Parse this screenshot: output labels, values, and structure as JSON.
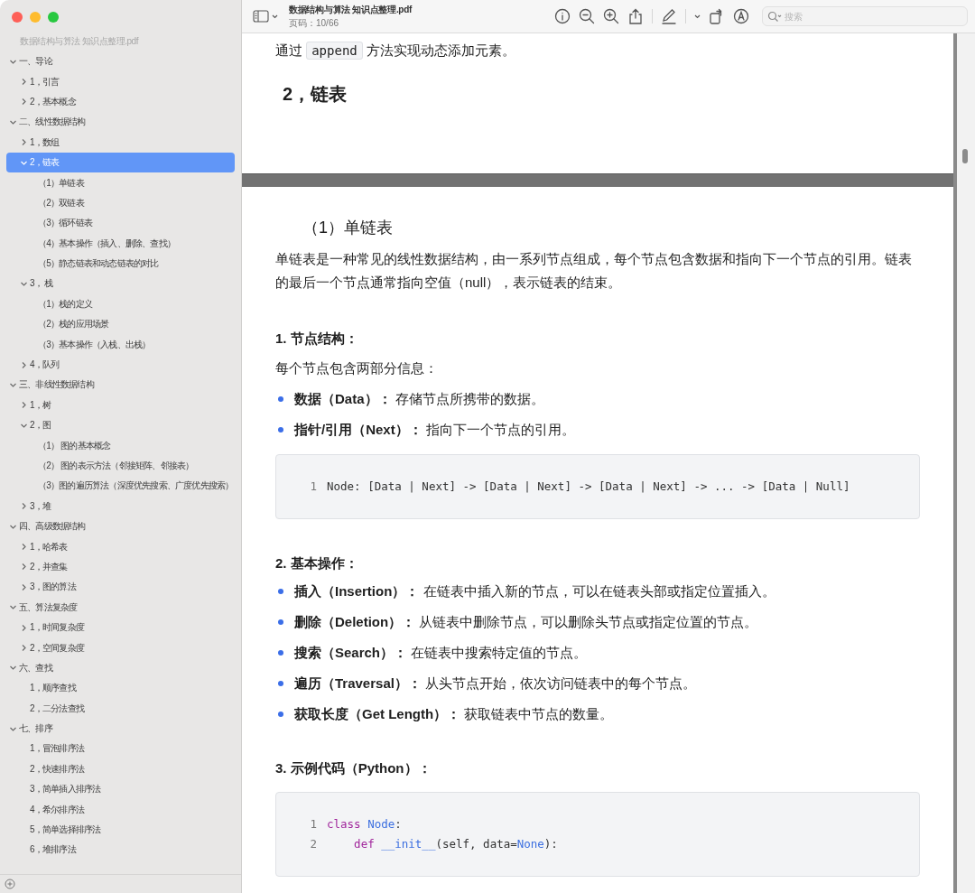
{
  "window": {
    "title": "数据结构与算法 知识点整理.pdf",
    "page_indicator": "页码：10/66"
  },
  "search": {
    "placeholder": "搜索"
  },
  "sidebar": {
    "title": "数据结构与算法 知识点整理.pdf",
    "outline": [
      {
        "label": "一、导论",
        "kind": "branch",
        "expanded": true,
        "selected": false,
        "children": [
          {
            "label": "1，引言",
            "kind": "branch",
            "expanded": false,
            "selected": false
          },
          {
            "label": "2，基本概念",
            "kind": "branch",
            "expanded": false,
            "selected": false
          }
        ]
      },
      {
        "label": "二、线性数据结构",
        "kind": "branch",
        "expanded": true,
        "selected": false,
        "children": [
          {
            "label": "1，数组",
            "kind": "branch",
            "expanded": false,
            "selected": false
          },
          {
            "label": "2，链表",
            "kind": "branch",
            "expanded": true,
            "selected": true,
            "children": [
              {
                "label": "（1）单链表",
                "kind": "leaf",
                "selected": false
              },
              {
                "label": "（2）双链表",
                "kind": "leaf",
                "selected": false
              },
              {
                "label": "（3）循环链表",
                "kind": "leaf",
                "selected": false
              },
              {
                "label": "（4）基本操作（插入、删除、查找）",
                "kind": "leaf",
                "selected": false
              },
              {
                "label": "（5）静态链表和动态链表的对比",
                "kind": "leaf",
                "selected": false
              }
            ]
          },
          {
            "label": "3， 栈",
            "kind": "branch",
            "expanded": true,
            "selected": false,
            "children": [
              {
                "label": "（1）栈的定义",
                "kind": "leaf",
                "selected": false
              },
              {
                "label": "（2）栈的应用场景",
                "kind": "leaf",
                "selected": false
              },
              {
                "label": "（3）基本操作（入栈、出栈）",
                "kind": "leaf",
                "selected": false
              }
            ]
          },
          {
            "label": "4，队列",
            "kind": "branch",
            "expanded": false,
            "selected": false
          }
        ]
      },
      {
        "label": "三、非线性数据结构",
        "kind": "branch",
        "expanded": true,
        "selected": false,
        "children": [
          {
            "label": "1，树",
            "kind": "branch",
            "expanded": false,
            "selected": false
          },
          {
            "label": "2，图",
            "kind": "branch",
            "expanded": true,
            "selected": false,
            "children": [
              {
                "label": "（1） 图的基本概念",
                "kind": "leaf",
                "selected": false
              },
              {
                "label": "（2） 图的表示方法（邻接矩阵、邻接表）",
                "kind": "leaf",
                "selected": false
              },
              {
                "label": "（3）图的遍历算法（深度优先搜索、广度优先搜索）",
                "kind": "leaf",
                "selected": false
              }
            ]
          },
          {
            "label": "3，堆",
            "kind": "branch",
            "expanded": false,
            "selected": false
          }
        ]
      },
      {
        "label": "四、高级数据结构",
        "kind": "branch",
        "expanded": true,
        "selected": false,
        "children": [
          {
            "label": "1，哈希表",
            "kind": "branch",
            "expanded": false,
            "selected": false
          },
          {
            "label": "2，并查集",
            "kind": "branch",
            "expanded": false,
            "selected": false
          },
          {
            "label": "3，图的算法",
            "kind": "branch",
            "expanded": false,
            "selected": false
          }
        ]
      },
      {
        "label": "五、算法复杂度",
        "kind": "branch",
        "expanded": true,
        "selected": false,
        "children": [
          {
            "label": "1，时间复杂度",
            "kind": "branch",
            "expanded": false,
            "selected": false
          },
          {
            "label": "2，空间复杂度",
            "kind": "branch",
            "expanded": false,
            "selected": false
          }
        ]
      },
      {
        "label": "六、查找",
        "kind": "branch",
        "expanded": true,
        "selected": false,
        "children": [
          {
            "label": "1，顺序查找",
            "kind": "leaf",
            "selected": false
          },
          {
            "label": "2，二分法查找",
            "kind": "leaf",
            "selected": false
          }
        ]
      },
      {
        "label": "七、排序",
        "kind": "branch",
        "expanded": true,
        "selected": false,
        "children": [
          {
            "label": "1，冒泡排序法",
            "kind": "leaf",
            "selected": false
          },
          {
            "label": "2，快速排序法",
            "kind": "leaf",
            "selected": false
          },
          {
            "label": "3，简单插入排序法",
            "kind": "leaf",
            "selected": false
          },
          {
            "label": "4，希尔排序法",
            "kind": "leaf",
            "selected": false
          },
          {
            "label": "5，简单选择排序法",
            "kind": "leaf",
            "selected": false
          },
          {
            "label": "6，堆排序法",
            "kind": "leaf",
            "selected": false
          }
        ]
      }
    ]
  },
  "document": {
    "pages": [
      {
        "blocks": [
          {
            "kind": "paragraph",
            "parts": [
              {
                "text": "通过 ",
                "kind": "plain"
              },
              {
                "text": "append",
                "kind": "code"
              },
              {
                "text": " 方法实现动态添加元素。",
                "kind": "plain"
              }
            ]
          },
          {
            "kind": "heading",
            "text": "2，链表"
          }
        ]
      },
      {
        "blocks": [
          {
            "kind": "subheading",
            "text": "（1）单链表"
          },
          {
            "kind": "paragraph",
            "parts": [
              {
                "text": "单链表是一种常见的线性数据结构，由一系列节点组成，每个节点包含数据和指向下一个节点的引用。链表的最后一个节点通常指向空值（null），表示链表的结束。",
                "kind": "plain"
              }
            ]
          },
          {
            "kind": "section",
            "text": "1. 节点结构："
          },
          {
            "kind": "paragraph",
            "parts": [
              {
                "text": "每个节点包含两部分信息：",
                "kind": "plain"
              }
            ]
          },
          {
            "kind": "bullets",
            "items": [
              "**数据（Data）：** 存储节点所携带的数据。",
              "**指针/引用（Next）：** 指向下一个节点的引用。"
            ]
          },
          {
            "kind": "code",
            "lines": [
              {
                "number": "1",
                "tokens": [
                  {
                    "text": "Node: [Data | Next] -> [Data | Next] -> [Data | Next] -> ... -> [Data | Null]",
                    "kind": "plain"
                  }
                ]
              }
            ]
          },
          {
            "kind": "section",
            "text": "2. 基本操作："
          },
          {
            "kind": "bullets",
            "items": [
              "**插入（Insertion）：** 在链表中插入新的节点，可以在链表头部或指定位置插入。",
              "**删除（Deletion）：** 从链表中删除节点，可以删除头节点或指定位置的节点。",
              "**搜索（Search）：** 在链表中搜索特定值的节点。",
              "**遍历（Traversal）：** 从头节点开始，依次访问链表中的每个节点。",
              "**获取长度（Get Length）：** 获取链表中节点的数量。"
            ]
          },
          {
            "kind": "section",
            "text": "3. 示例代码（Python）："
          },
          {
            "kind": "code",
            "lines": [
              {
                "number": "1",
                "tokens": [
                  {
                    "text": "class",
                    "kind": "keyword"
                  },
                  {
                    "text": " Node",
                    "kind": "name"
                  },
                  {
                    "text": ":",
                    "kind": "plain"
                  }
                ]
              },
              {
                "number": "2",
                "tokens": [
                  {
                    "text": "    def",
                    "kind": "keyword"
                  },
                  {
                    "text": " __init__",
                    "kind": "name"
                  },
                  {
                    "text": "(self, data=",
                    "kind": "plain"
                  },
                  {
                    "text": "None",
                    "kind": "name"
                  },
                  {
                    "text": "):",
                    "kind": "plain"
                  }
                ]
              }
            ]
          }
        ]
      }
    ]
  }
}
